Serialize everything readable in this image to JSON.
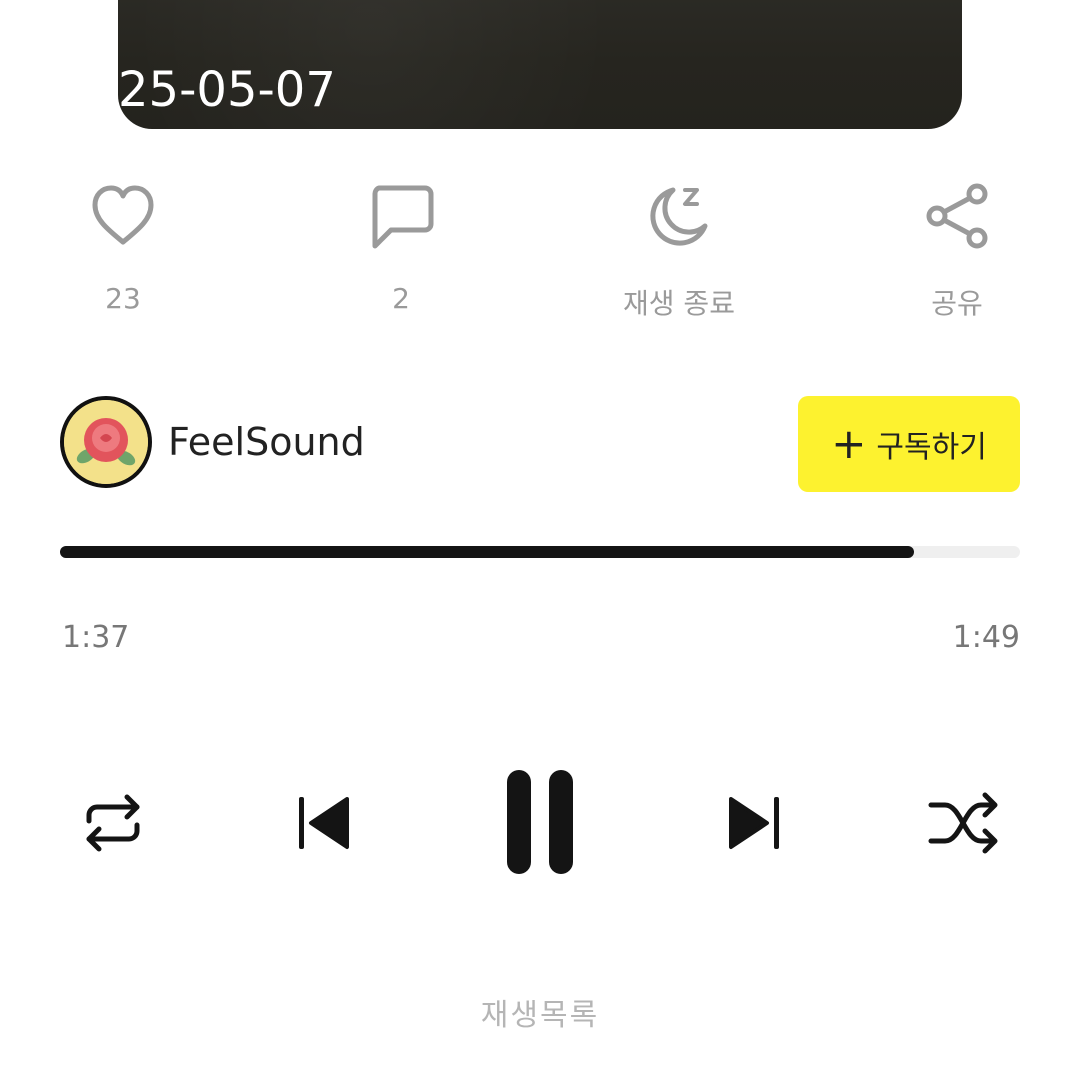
{
  "cover": {
    "date": "25-05-07"
  },
  "actions": {
    "like_count": "23",
    "comment_count": "2",
    "sleep_label": "재생 종료",
    "share_label": "공유"
  },
  "artist": {
    "name": "FeelSound",
    "subscribe_label": "구독하기"
  },
  "player": {
    "current_time": "1:37",
    "total_time": "1:49",
    "progress": 0.89
  },
  "footer": {
    "label": "재생목록"
  },
  "colors": {
    "accent": "#fdf22f",
    "progress_fill": "#141414",
    "icon_gray": "#9a9a9a"
  }
}
